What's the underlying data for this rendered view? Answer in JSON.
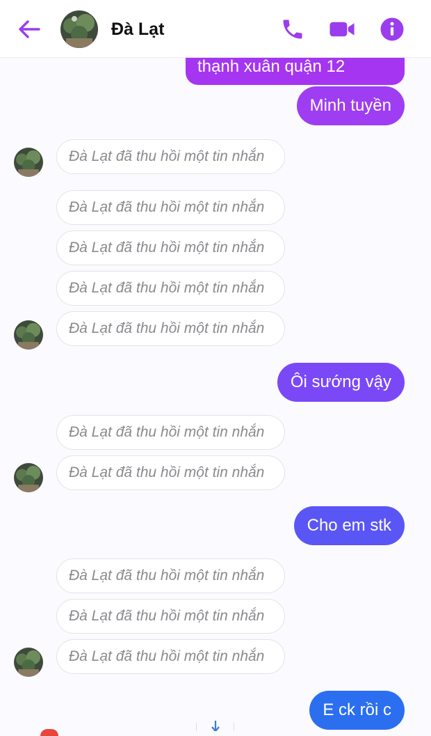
{
  "header": {
    "contact_name": "Đà Lạt",
    "accent_color": "#9b3dec",
    "icons": [
      "back-arrow-icon",
      "phone-icon",
      "video-camera-icon",
      "info-icon"
    ]
  },
  "messages": {
    "top_partial": "thạnh xuân quận 12",
    "sent_1": "Minh tuyền",
    "sent_2": "Ôi sướng vậy",
    "sent_3": "Cho em stk",
    "sent_4": "E ck rồi c",
    "recalled_text": "Đà Lạt đã thu hồi một tin nhắn"
  },
  "colors": {
    "purple_bubble": "#a535f0",
    "violet_bubble": "#7a48f7",
    "indigo_bubble": "#5a56f5",
    "blue_bubble": "#2b6ff0",
    "recalled_border": "#e3e3e8"
  }
}
